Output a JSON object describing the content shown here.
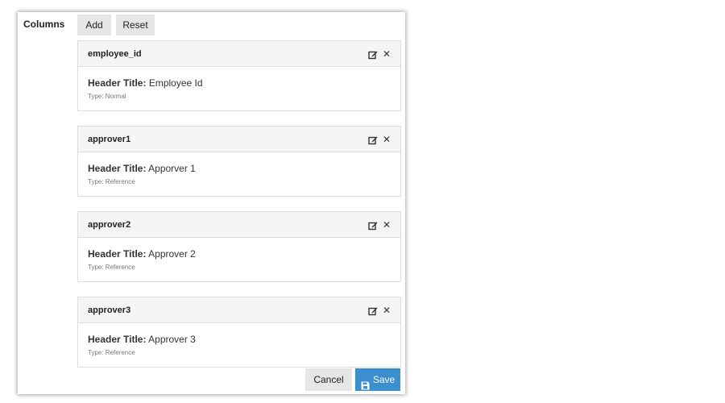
{
  "section_label": "Columns",
  "toolbar": {
    "add_label": "Add",
    "reset_label": "Reset"
  },
  "columns": [
    {
      "name": "employee_id",
      "header_key": "Header Title:",
      "header_value": "Employee Id",
      "type": "Type: Normal"
    },
    {
      "name": "approver1",
      "header_key": "Header Title:",
      "header_value": "Apporver 1",
      "type": "Type: Reference"
    },
    {
      "name": "approver2",
      "header_key": "Header Title:",
      "header_value": "Approver 2",
      "type": "Type: Reference"
    },
    {
      "name": "approver3",
      "header_key": "Header Title:",
      "header_value": "Approver 3",
      "type": "Type: Reference"
    }
  ],
  "icons": {
    "edit": "edit-icon",
    "close": "close-icon",
    "save": "floppy-disk-icon"
  },
  "footer": {
    "cancel_label": "Cancel",
    "save_label": "Save"
  },
  "colors": {
    "save_button": "#3b8fd1",
    "header_bg": "#f5f5f5",
    "button_bg": "#e6e6e6"
  }
}
